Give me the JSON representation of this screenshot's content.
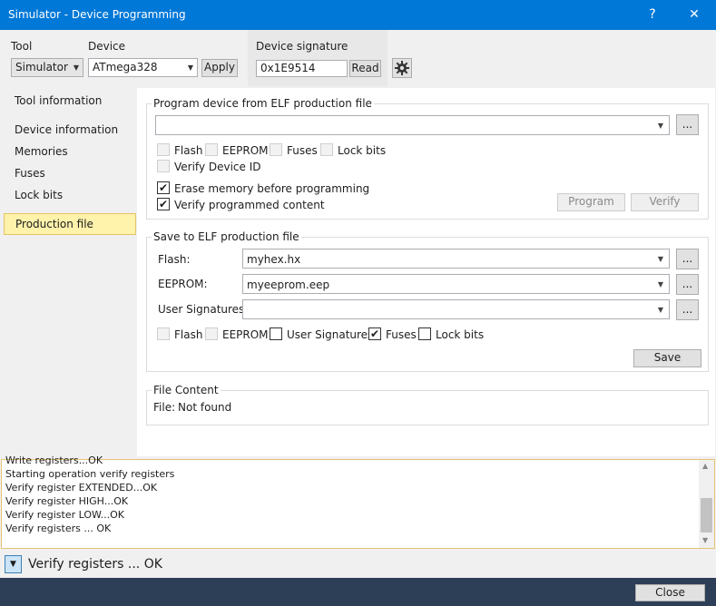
{
  "window": {
    "title": "Simulator - Device Programming",
    "help_label": "?",
    "close_label": "✕"
  },
  "header": {
    "tool_label": "Tool",
    "tool_value": "Simulator",
    "device_label": "Device",
    "device_value": "ATmega328",
    "apply_label": "Apply",
    "signature_label": "Device signature",
    "signature_value": "0x1E9514",
    "read_label": "Read"
  },
  "sidebar": {
    "items": [
      {
        "label": "Tool information"
      },
      {
        "label": "Device information"
      },
      {
        "label": "Memories"
      },
      {
        "label": "Fuses"
      },
      {
        "label": "Lock bits"
      },
      {
        "label": "Production file"
      }
    ],
    "selected": "Production file"
  },
  "program_group": {
    "title": "Program device from ELF production file",
    "file_value": "",
    "browse_label": "...",
    "checkboxes": {
      "flash": {
        "label": "Flash",
        "checked": false,
        "disabled": true
      },
      "eeprom": {
        "label": "EEPROM",
        "checked": false,
        "disabled": true
      },
      "fuses": {
        "label": "Fuses",
        "checked": false,
        "disabled": true
      },
      "lockbits": {
        "label": "Lock bits",
        "checked": false,
        "disabled": true
      },
      "verify_id": {
        "label": "Verify Device ID",
        "checked": false,
        "disabled": true
      },
      "erase": {
        "label": "Erase memory before programming",
        "checked": true,
        "disabled": false
      },
      "verify_content": {
        "label": "Verify programmed content",
        "checked": true,
        "disabled": false
      }
    },
    "program_label": "Program",
    "verify_label": "Verify"
  },
  "save_group": {
    "title": "Save to ELF production file",
    "flash_label": "Flash:",
    "flash_value": "myhex.hx",
    "eeprom_label": "EEPROM:",
    "eeprom_value": "myeeprom.eep",
    "usersig_label": "User Signatures:",
    "usersig_value": "",
    "browse_label": "...",
    "checkboxes": {
      "flash": {
        "label": "Flash",
        "checked": false,
        "disabled": true
      },
      "eeprom": {
        "label": "EEPROM",
        "checked": false,
        "disabled": true
      },
      "usersig": {
        "label": "User Signatures",
        "checked": false,
        "disabled": false
      },
      "fuses": {
        "label": "Fuses",
        "checked": true,
        "disabled": false
      },
      "lockbits": {
        "label": "Lock bits",
        "checked": false,
        "disabled": false
      }
    },
    "save_label": "Save"
  },
  "file_content": {
    "title": "File Content",
    "file_label": "File:",
    "file_status": "Not found"
  },
  "log": {
    "lines": [
      "Write registers...OK",
      "Starting operation verify registers",
      "Verify register EXTENDED...OK",
      "Verify register HIGH...OK",
      "Verify register LOW...OK",
      "Verify registers ... OK"
    ]
  },
  "status": {
    "text": "Verify registers ... OK"
  },
  "footer": {
    "close_label": "Close"
  },
  "colors": {
    "titlebar": "#0078d7",
    "footer": "#2d3e57",
    "selected_item": "#fff2ab",
    "log_border": "#e4c372"
  }
}
